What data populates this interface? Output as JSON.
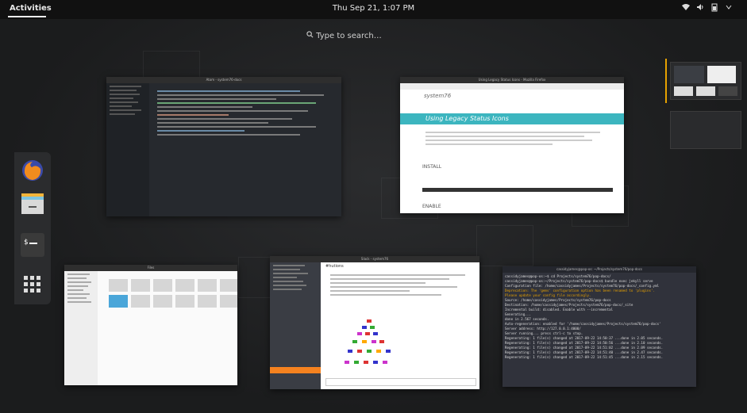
{
  "topbar": {
    "activities": "Activities",
    "clock": "Thu Sep 21,  1:07 PM"
  },
  "search": {
    "placeholder": "Type to search…"
  },
  "windows": {
    "editor_title": "Atom - system76-docs",
    "browser_title": "Using Legacy Status Icons - Mozilla Firefox",
    "browser_heading": "Using Legacy Status Icons",
    "browser_brand": "system76",
    "browser_section_install": "INSTALL",
    "browser_section_enable": "ENABLE",
    "files_title": "Files",
    "chat_title": "Slack - system76",
    "chat_channel": "#hutions",
    "terminal_title": "cassidyjames@pop-os: ~/Projects/system76/pop-docs",
    "terminal_lines": [
      "cassidyjames@pop-os:~$ cd Projects/system76/pop-docs/",
      "cassidyjames@pop-os:~/Projects/system76/pop-docs$ bundle exec jekyll serve",
      "Configuration file: /home/cassidyjames/Projects/system76/pop-docs/_config.yml",
      "      Deprecation: The 'gems' configuration option has been renamed to 'plugins'.",
      "                   Please update your config file accordingly.",
      "           Source: /home/cassidyjames/Projects/system76/pop-docs",
      "      Destination: /home/cassidyjames/Projects/system76/pop-docs/_site",
      " Incremental build: disabled. Enable with --incremental",
      "      Generating...",
      "                   done in 2.567 seconds.",
      " Auto-regeneration: enabled for '/home/cassidyjames/Projects/system76/pop-docs'",
      "    Server address: http://127.0.0.1:4000/",
      "  Server running... press ctrl-c to stop.",
      "      Regenerating: 1 file(s) changed at 2017-09-22 14:50:37 ...done in 2.05 seconds.",
      "      Regenerating: 1 file(s) changed at 2017-09-22 14:50:56 ...done in 2.10 seconds.",
      "      Regenerating: 1 file(s) changed at 2017-09-22 14:51:02 ...done in 2.09 seconds.",
      "      Regenerating: 1 file(s) changed at 2017-09-22 14:51:40 ...done in 2.47 seconds.",
      "      Regenerating: 1 file(s) changed at 2017-09-22 14:51:45 ...done in 2.15 seconds."
    ]
  },
  "colors": {
    "accent": "#e6a100",
    "system76_teal": "#3cb5bf",
    "slack_orange": "#f5821f"
  },
  "icons": [
    "firefox-icon",
    "files-icon",
    "terminal-icon",
    "app-grid-icon",
    "network-icon",
    "volume-icon",
    "battery-icon",
    "power-icon"
  ]
}
